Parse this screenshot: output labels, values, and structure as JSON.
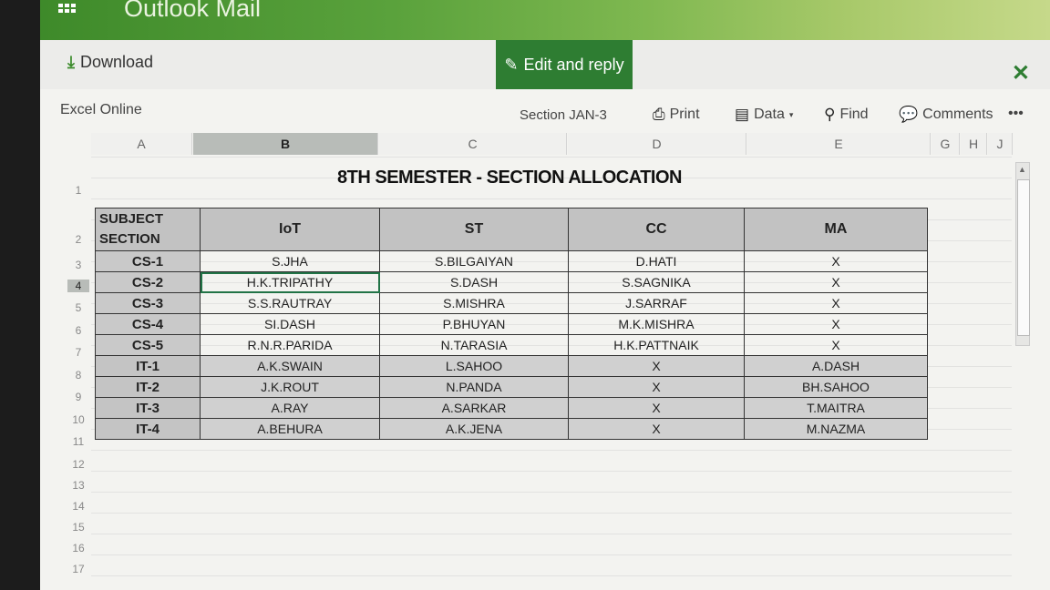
{
  "app": {
    "title": "Outlook Mail"
  },
  "actions": {
    "download": "Download",
    "edit_reply": "Edit and reply"
  },
  "excel": {
    "label": "Excel Online",
    "doc_name": "Section JAN-3",
    "toolbar": {
      "print": "Print",
      "data": "Data",
      "find": "Find",
      "comments": "Comments",
      "more": "•••"
    }
  },
  "columns": [
    "A",
    "B",
    "C",
    "D",
    "E",
    "G",
    "H",
    "J"
  ],
  "rows": [
    "1",
    "2",
    "3",
    "4",
    "5",
    "6",
    "7",
    "8",
    "9",
    "10",
    "11",
    "12",
    "13",
    "14",
    "15",
    "16",
    "17"
  ],
  "sheet": {
    "title": "8TH SEMESTER - SECTION ALLOCATION",
    "corner_top": "SUBJECT",
    "corner_bottom": "SECTION",
    "headers": [
      "IoT",
      "ST",
      "CC",
      "MA"
    ],
    "data": [
      [
        "CS-1",
        "S.JHA",
        "S.BILGAIYAN",
        "D.HATI",
        "X"
      ],
      [
        "CS-2",
        "H.K.TRIPATHY",
        "S.DASH",
        "S.SAGNIKA",
        "X"
      ],
      [
        "CS-3",
        "S.S.RAUTRAY",
        "S.MISHRA",
        "J.SARRAF",
        "X"
      ],
      [
        "CS-4",
        "SI.DASH",
        "P.BHUYAN",
        "M.K.MISHRA",
        "X"
      ],
      [
        "CS-5",
        "R.N.R.PARIDA",
        "N.TARASIA",
        "H.K.PATTNAIK",
        "X"
      ],
      [
        "IT-1",
        "A.K.SWAIN",
        "L.SAHOO",
        "X",
        "A.DASH"
      ],
      [
        "IT-2",
        "J.K.ROUT",
        "N.PANDA",
        "X",
        "BH.SAHOO"
      ],
      [
        "IT-3",
        "A.RAY",
        "A.SARKAR",
        "X",
        "T.MAITRA"
      ],
      [
        "IT-4",
        "A.BEHURA",
        "A.K.JENA",
        "X",
        "M.NAZMA"
      ]
    ]
  },
  "colors": {
    "accent": "#2e7d32",
    "header_bg": "#c2c2c2"
  }
}
